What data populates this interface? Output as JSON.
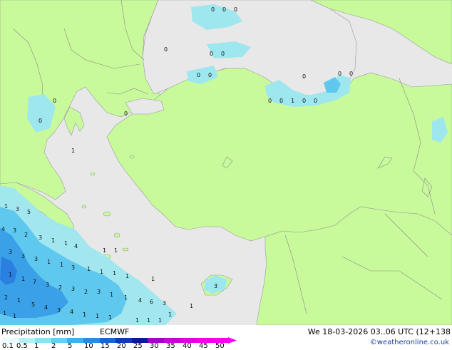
{
  "map": {
    "colors": {
      "sea": "#e8e8e8",
      "land": "#c8fa9c",
      "precip_light": "#9ee7ef",
      "precip_mid": "#5fc8ee",
      "precip_heavy": "#3aa0e8",
      "precip_strong": "#2a7fe0"
    },
    "value_labels": [
      "1",
      "3",
      "5",
      "4",
      "3",
      "2",
      "3",
      "1",
      "1",
      "4",
      "3",
      "3",
      "3",
      "1",
      "1",
      "3",
      "1",
      "1",
      "1",
      "1",
      "1",
      "1",
      "1",
      "1",
      "1",
      "1",
      "1",
      "7",
      "3",
      "2",
      "3",
      "2",
      "3",
      "1",
      "1",
      "4",
      "6",
      "3",
      "2",
      "1",
      "1",
      "1",
      "1",
      "1",
      "1",
      "1",
      "1",
      "5",
      "4",
      "3",
      "4",
      "1",
      "1",
      "1",
      "3",
      "0",
      "0",
      "0",
      "0",
      "0",
      "0",
      "0",
      "0",
      "0",
      "0",
      "0",
      "0",
      "0",
      "0",
      "0",
      "0",
      "0",
      "0"
    ]
  },
  "footer": {
    "title": "Precipitation [mm]",
    "model": "ECMWF",
    "datetime": "We 18-03-2026 03..06 UTC (12+138",
    "credit": "©weatheronline.co.uk",
    "legend_ticks": [
      "0.1",
      "0.5",
      "1",
      "2",
      "5",
      "10",
      "15",
      "20",
      "25",
      "30",
      "35",
      "40",
      "45",
      "50"
    ],
    "legend_colors": [
      "#e8fcfe",
      "#b4f0f6",
      "#8ce2f0",
      "#64cfee",
      "#3cb1ea",
      "#2a8be2",
      "#1c62d4",
      "#1038b8",
      "#0a1896",
      "#a000c8",
      "#c800d8",
      "#e000e0",
      "#f000e8",
      "#f800f0"
    ]
  }
}
